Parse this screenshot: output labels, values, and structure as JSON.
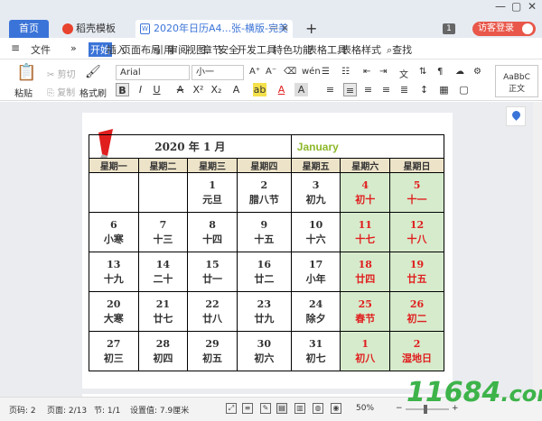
{
  "tabs": {
    "home": "首页",
    "daoke": "稻壳模板",
    "doc": "2020年日历A4...张-横版-完美版)",
    "add": "+",
    "badge": "1",
    "login": "访客登录"
  },
  "window_controls": [
    "—",
    "▢",
    "✕"
  ],
  "menu": {
    "file": "文件",
    "more": "»",
    "items": [
      "开始",
      "插入",
      "页面布局",
      "引用",
      "审阅",
      "视图",
      "章节",
      "安全",
      "开发工具",
      "特色功能",
      "表格工具",
      "表格样式"
    ],
    "search": "查找"
  },
  "toolbar": {
    "paste": "粘贴",
    "cut": "剪切",
    "copy": "复制",
    "format_painter": "格式刷",
    "font_name": "Arial",
    "font_size": "小一",
    "format_buttons": [
      "B",
      "I",
      "U",
      "A",
      "X²",
      "X₂",
      "A",
      "ab",
      "A",
      "A"
    ],
    "style_preview": "AaBbC",
    "style_name": "正文"
  },
  "calendar": {
    "title": "2020 年 1 月",
    "english_month": "January",
    "weekdays": [
      "星期一",
      "星期二",
      "星期三",
      "星期四",
      "星期五",
      "星期六",
      "星期日"
    ],
    "weeks": [
      [
        null,
        null,
        {
          "d": "1",
          "l": "元旦"
        },
        {
          "d": "2",
          "l": "腊八节"
        },
        {
          "d": "3",
          "l": "初九"
        },
        {
          "d": "4",
          "l": "初十"
        },
        {
          "d": "5",
          "l": "十一"
        }
      ],
      [
        {
          "d": "6",
          "l": "小寒"
        },
        {
          "d": "7",
          "l": "十三"
        },
        {
          "d": "8",
          "l": "十四"
        },
        {
          "d": "9",
          "l": "十五"
        },
        {
          "d": "10",
          "l": "十六"
        },
        {
          "d": "11",
          "l": "十七"
        },
        {
          "d": "12",
          "l": "十八"
        }
      ],
      [
        {
          "d": "13",
          "l": "十九"
        },
        {
          "d": "14",
          "l": "二十"
        },
        {
          "d": "15",
          "l": "廿一"
        },
        {
          "d": "16",
          "l": "廿二"
        },
        {
          "d": "17",
          "l": "小年"
        },
        {
          "d": "18",
          "l": "廿四"
        },
        {
          "d": "19",
          "l": "廿五"
        }
      ],
      [
        {
          "d": "20",
          "l": "大寒"
        },
        {
          "d": "21",
          "l": "廿七"
        },
        {
          "d": "22",
          "l": "廿八"
        },
        {
          "d": "23",
          "l": "廿九"
        },
        {
          "d": "24",
          "l": "除夕"
        },
        {
          "d": "25",
          "l": "春节"
        },
        {
          "d": "26",
          "l": "初二"
        }
      ],
      [
        {
          "d": "27",
          "l": "初三"
        },
        {
          "d": "28",
          "l": "初四"
        },
        {
          "d": "29",
          "l": "初五"
        },
        {
          "d": "30",
          "l": "初六"
        },
        {
          "d": "31",
          "l": "初七"
        },
        {
          "d": "1",
          "l": "初八"
        },
        {
          "d": "2",
          "l": "湿地日"
        }
      ]
    ],
    "colors": {
      "header_bg": "#ede3c8",
      "weekend_bg": "#d6ebcc",
      "weekend_text": "#e01e1e",
      "month_en": "#8db82b"
    }
  },
  "status": {
    "page_num": "页码: 2",
    "page_count": "页面: 2/13",
    "section": "节: 1/1",
    "setting": "设置值: 7.9厘米",
    "zoom": "50%",
    "zoom_minus": "−",
    "zoom_plus": "+"
  },
  "watermark": {
    "main": "11684",
    "suffix": ".com"
  }
}
